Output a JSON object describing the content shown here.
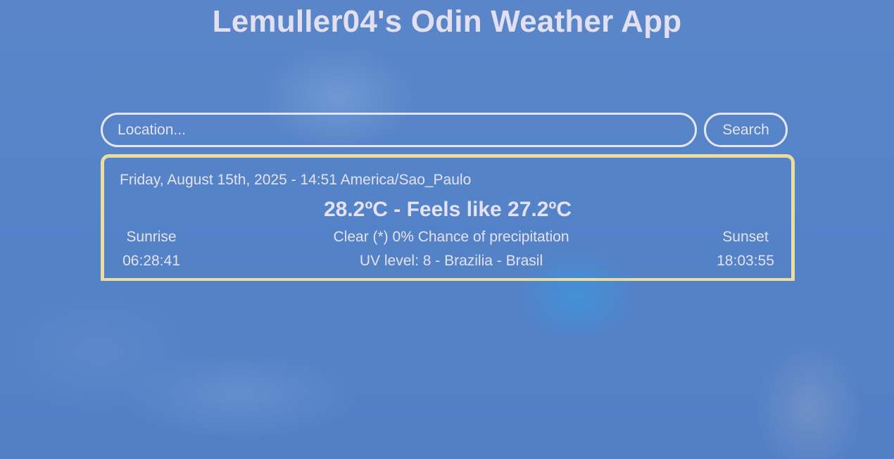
{
  "header": {
    "title": "Lemuller04's Odin Weather App"
  },
  "search": {
    "placeholder": "Location...",
    "value": "",
    "button_label": "Search"
  },
  "weather": {
    "datetime": "Friday, August 15th, 2025 - 14:51 America/Sao_Paulo",
    "temperature_line": "28.2ºC - Feels like 27.2ºC",
    "sunrise_label": "Sunrise",
    "sunrise_time": "06:28:41",
    "conditions": "Clear (*) 0% Chance of precipitation",
    "uv_location": "UV level: 8 - Brazilia - Brasil",
    "sunset_label": "Sunset",
    "sunset_time": "18:03:55"
  },
  "colors": {
    "background": "#5581c6",
    "text": "#e4e2f2",
    "card_border": "#ecdc9e",
    "input_border": "#e6e4f3"
  }
}
